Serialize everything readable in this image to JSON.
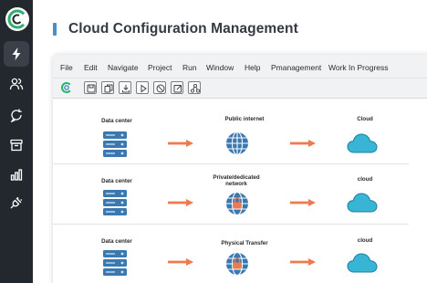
{
  "page": {
    "title": "Cloud Configuration Management",
    "accent_color": "#4a90c8"
  },
  "sidebar": {
    "items": [
      {
        "icon": "logo-icon"
      },
      {
        "icon": "lightning-icon",
        "active": true
      },
      {
        "icon": "users-icon"
      },
      {
        "icon": "chat-refresh-icon"
      },
      {
        "icon": "archive-icon"
      },
      {
        "icon": "bar-chart-icon"
      },
      {
        "icon": "plug-icon"
      }
    ]
  },
  "menu": {
    "items": [
      "File",
      "Edit",
      "Navigate",
      "Project",
      "Run",
      "Window",
      "Help",
      "Pmanagement",
      "Work In Progress"
    ]
  },
  "toolbar": {
    "buttons": [
      "save-icon",
      "copy-icon",
      "download-icon",
      "play-icon",
      "stop-icon",
      "edit-icon",
      "network-icon"
    ]
  },
  "diagram": {
    "colors": {
      "server": "#3b78b0",
      "globe": "#3b78b0",
      "cloud": "#38b4d4",
      "arrow": "#ee7b4f"
    },
    "rows": [
      {
        "source": "Data center",
        "middle": "Public internet",
        "target": "Cloud"
      },
      {
        "source": "Data center",
        "middle": "Private/dedicated network",
        "target": "cloud"
      },
      {
        "source": "Data center",
        "middle": "Physical Transfer",
        "target": "cloud"
      }
    ]
  }
}
